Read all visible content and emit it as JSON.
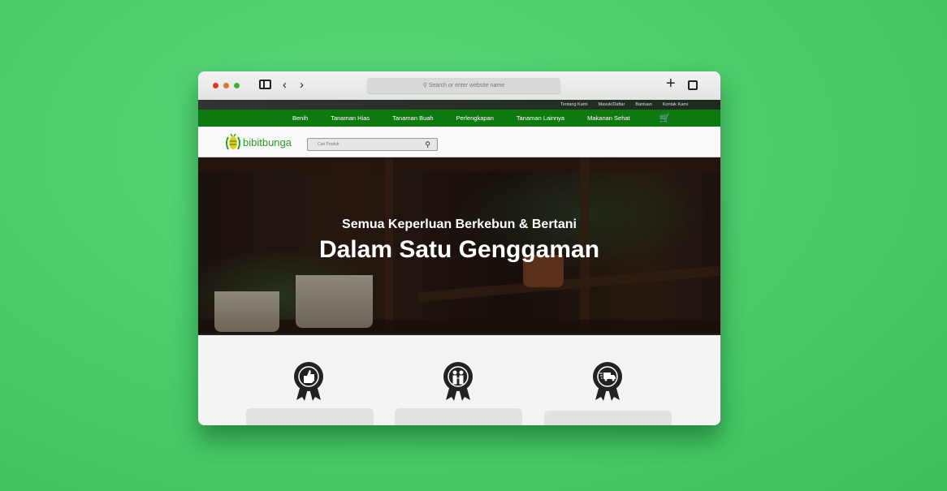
{
  "browser": {
    "address_placeholder": "Search or enter website name",
    "traffic_colors": [
      "#e0332b",
      "#e0722b",
      "#3bb33b"
    ]
  },
  "topbar": {
    "links": [
      "Tentang Kami",
      "Masuk/Daftar",
      "Bantuan",
      "Kontak Kami"
    ]
  },
  "nav": {
    "items": [
      "Benih",
      "Tanaman Hias",
      "Tanaman Buah",
      "Perlengkapan",
      "Tanaman Lainnya",
      "Makanan Sehat"
    ],
    "color": "#0d7a10"
  },
  "header": {
    "logo": "bibitbunga",
    "search_placeholder": "Cari Produk"
  },
  "hero": {
    "subtitle": "Semua Keperluan Berkebun & Bertani",
    "title": "Dalam Satu Genggaman"
  },
  "features": [
    {
      "icon": "thumbs-up-badge-icon"
    },
    {
      "icon": "handshake-badge-icon"
    },
    {
      "icon": "delivery-truck-badge-icon"
    }
  ]
}
